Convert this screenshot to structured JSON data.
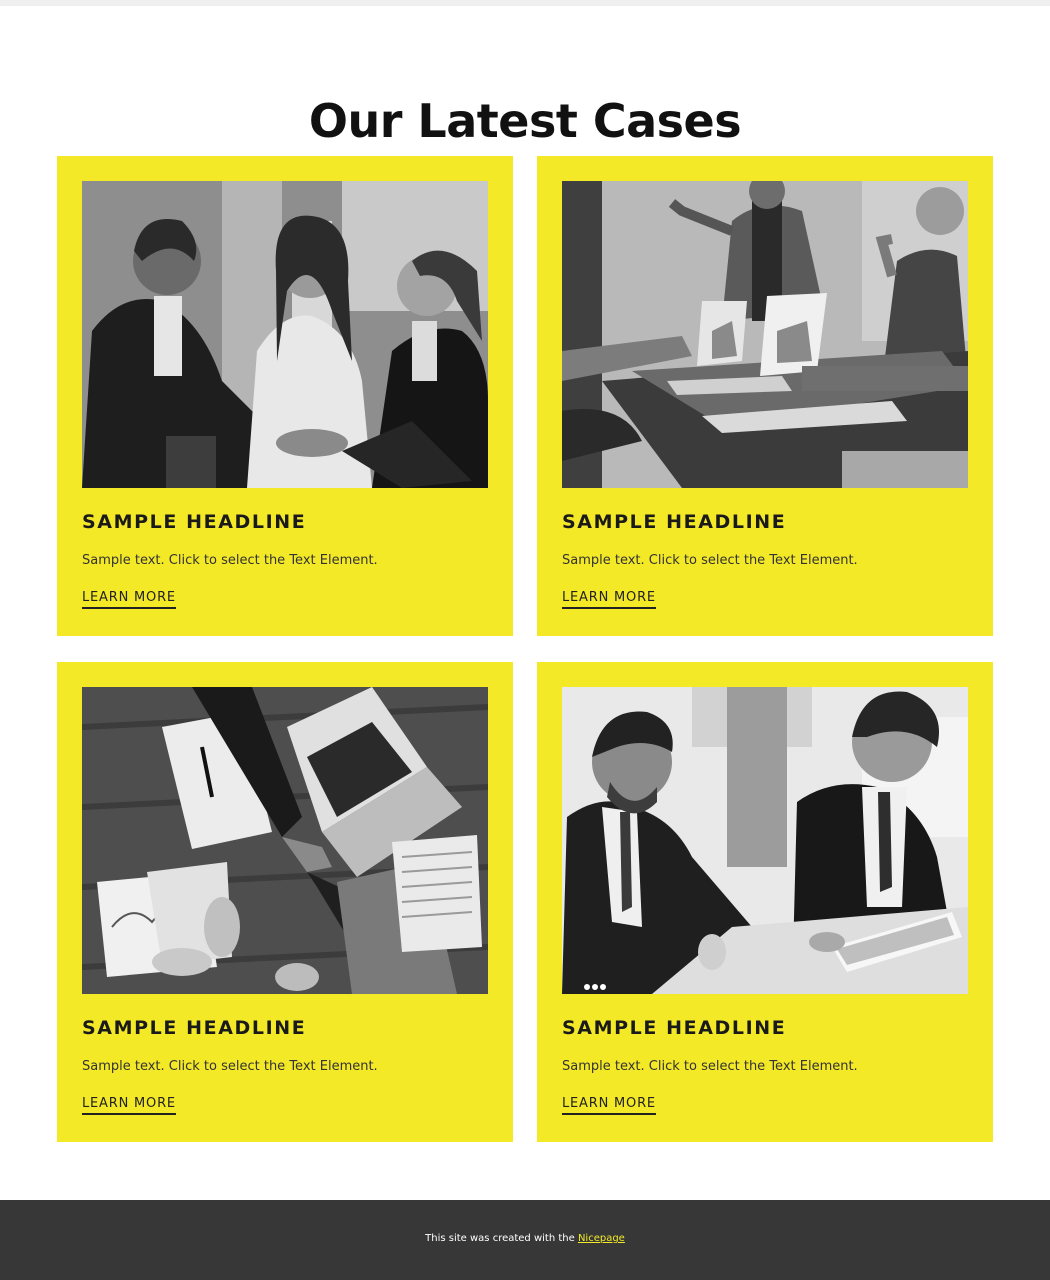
{
  "page": {
    "title": "Our Latest Cases"
  },
  "cards": [
    {
      "image": "photo-business-handshake",
      "headline": "SAMPLE HEADLINE",
      "text": "Sample text. Click to select the Text Element.",
      "link_label": "LEARN MORE"
    },
    {
      "image": "photo-office-presentation",
      "headline": "SAMPLE HEADLINE",
      "text": "Sample text. Click to select the Text Element.",
      "link_label": "LEARN MORE"
    },
    {
      "image": "photo-desk-handshake-top-view",
      "headline": "SAMPLE HEADLINE",
      "text": "Sample text. Click to select the Text Element.",
      "link_label": "LEARN MORE"
    },
    {
      "image": "photo-businessmen-with-tablet",
      "headline": "SAMPLE HEADLINE",
      "text": "Sample text. Click to select the Text Element.",
      "link_label": "LEARN MORE"
    }
  ],
  "footer": {
    "text": "This site was created with the",
    "link_label": "Nicepage"
  },
  "colors": {
    "card_background": "#f4e927",
    "footer_background": "#373737",
    "footer_link": "#f4e927",
    "title": "#111111"
  }
}
